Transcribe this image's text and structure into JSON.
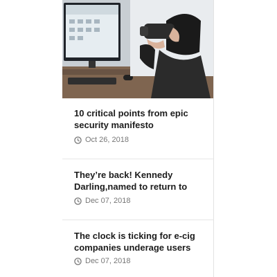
{
  "hero": {
    "alt": "Person wearing VR headset"
  },
  "articles": [
    {
      "title": "10 critical points from epic security manifesto",
      "date": "Oct 26, 2018"
    },
    {
      "title": "They’re back! Kennedy Darling,named to return to",
      "date": "Dec 07, 2018"
    },
    {
      "title": "The clock is ticking for e-cig companies underage users",
      "date": "Dec 07, 2018"
    }
  ],
  "icons": {
    "date": "clock-icon"
  },
  "colors": {
    "title": "#1c1c1c",
    "meta": "#777777",
    "divider": "#e6e6e6"
  }
}
